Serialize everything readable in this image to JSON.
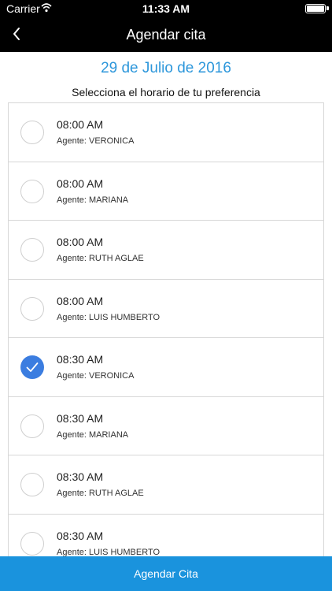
{
  "status_bar": {
    "carrier": "Carrier",
    "time": "11:33 AM",
    "battery_level": 1.0
  },
  "nav": {
    "title": "Agendar cita",
    "back_icon": "chevron-left-icon"
  },
  "date": "29 de Julio de 2016",
  "subtitle": "Selecciona el horario de tu preferencia",
  "slots": [
    {
      "time": "08:00 AM",
      "agent": "Agente: VERONICA",
      "selected": false
    },
    {
      "time": "08:00 AM",
      "agent": "Agente: MARIANA",
      "selected": false
    },
    {
      "time": "08:00 AM",
      "agent": "Agente: RUTH AGLAE",
      "selected": false
    },
    {
      "time": "08:00 AM",
      "agent": "Agente: LUIS HUMBERTO",
      "selected": false
    },
    {
      "time": "08:30 AM",
      "agent": "Agente: VERONICA",
      "selected": true
    },
    {
      "time": "08:30 AM",
      "agent": "Agente: MARIANA",
      "selected": false
    },
    {
      "time": "08:30 AM",
      "agent": "Agente: RUTH AGLAE",
      "selected": false
    },
    {
      "time": "08:30 AM",
      "agent": "Agente: LUIS HUMBERTO",
      "selected": false
    }
  ],
  "button": {
    "label": "Agendar Cita"
  },
  "colors": {
    "accent": "#2d97db",
    "button": "#1a93dd",
    "checked": "#3b7de0",
    "topbar": "#000000"
  }
}
